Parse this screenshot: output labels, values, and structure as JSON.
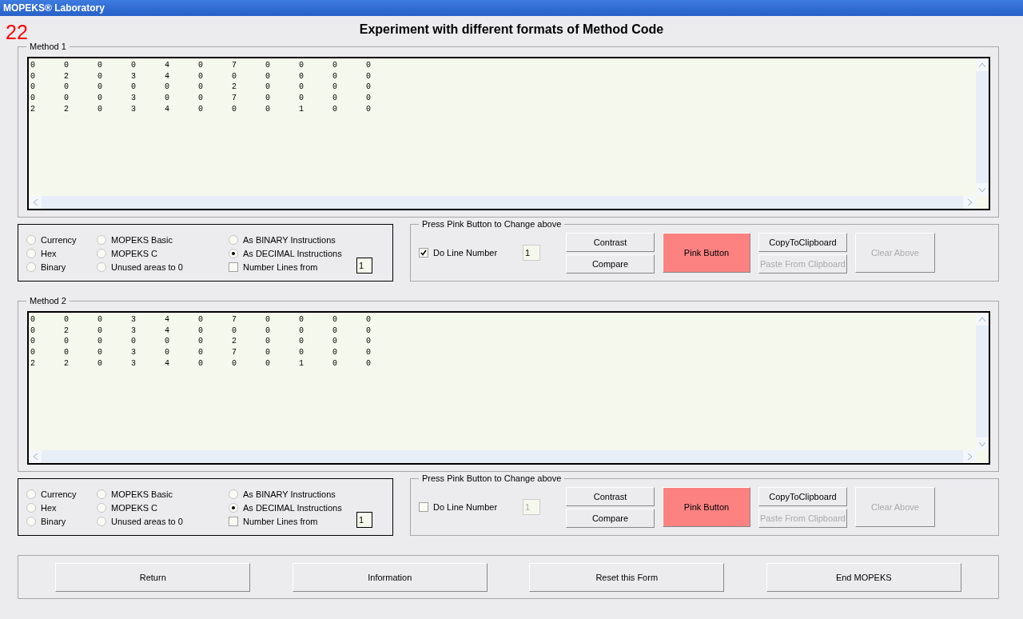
{
  "window": {
    "title": "MOPEKS® Laboratory"
  },
  "form_number": "22",
  "heading": "Experiment with different formats of Method Code",
  "methods": [
    {
      "label": "Method 1",
      "rows": [
        [
          "0",
          "0",
          "0",
          "0",
          "4",
          "0",
          "7",
          "0",
          "0",
          "0",
          "0"
        ],
        [
          "0",
          "2",
          "0",
          "3",
          "4",
          "0",
          "0",
          "0",
          "0",
          "0",
          "0"
        ],
        [
          "0",
          "0",
          "0",
          "0",
          "0",
          "0",
          "2",
          "0",
          "0",
          "0",
          "0"
        ],
        [
          "0",
          "0",
          "0",
          "3",
          "0",
          "0",
          "7",
          "0",
          "0",
          "0",
          "0"
        ],
        [
          "2",
          "2",
          "0",
          "3",
          "4",
          "0",
          "0",
          "0",
          "1",
          "0",
          "0"
        ]
      ],
      "options": [
        {
          "label": "Currency",
          "selected": false
        },
        {
          "label": "Hex",
          "selected": false
        },
        {
          "label": "Binary",
          "selected": false
        },
        {
          "label": "MOPEKS Basic",
          "selected": false
        },
        {
          "label": "MOPEKS C",
          "selected": false
        },
        {
          "label": "Unused areas to 0",
          "selected": false
        },
        {
          "label": "As BINARY Instructions",
          "selected": false
        },
        {
          "label": "As DECIMAL Instructions",
          "selected": true
        }
      ],
      "number_lines": {
        "label": "Number Lines  from",
        "checked": false,
        "value": "1"
      },
      "panel": {
        "legend": "Press Pink Button to Change above",
        "do_line_number": {
          "label": "Do Line Number",
          "checked": true,
          "value": "1"
        },
        "buttons": [
          {
            "label": "Contrast",
            "kind": "small",
            "disabled": false
          },
          {
            "label": "Compare",
            "kind": "small",
            "disabled": false
          },
          {
            "label": "Pink Button",
            "kind": "pink",
            "disabled": false
          },
          {
            "label": "CopyToClipboard",
            "kind": "small",
            "disabled": false
          },
          {
            "label": "Paste From Clipboard",
            "kind": "small",
            "disabled": true
          },
          {
            "label": "Clear Above",
            "kind": "tall",
            "disabled": true
          }
        ]
      }
    },
    {
      "label": "Method 2",
      "rows": [
        [
          "0",
          "0",
          "0",
          "3",
          "4",
          "0",
          "7",
          "0",
          "0",
          "0",
          "0"
        ],
        [
          "0",
          "2",
          "0",
          "3",
          "4",
          "0",
          "0",
          "0",
          "0",
          "0",
          "0"
        ],
        [
          "0",
          "0",
          "0",
          "0",
          "0",
          "0",
          "2",
          "0",
          "0",
          "0",
          "0"
        ],
        [
          "0",
          "0",
          "0",
          "3",
          "0",
          "0",
          "7",
          "0",
          "0",
          "0",
          "0"
        ],
        [
          "2",
          "2",
          "0",
          "3",
          "4",
          "0",
          "0",
          "0",
          "1",
          "0",
          "0"
        ]
      ],
      "options": [
        {
          "label": "Currency",
          "selected": false
        },
        {
          "label": "Hex",
          "selected": false
        },
        {
          "label": "Binary",
          "selected": false
        },
        {
          "label": "MOPEKS Basic",
          "selected": false
        },
        {
          "label": "MOPEKS C",
          "selected": false
        },
        {
          "label": "Unused areas to 0",
          "selected": false
        },
        {
          "label": "As BINARY Instructions",
          "selected": false
        },
        {
          "label": "As DECIMAL Instructions",
          "selected": true
        }
      ],
      "number_lines": {
        "label": "Number Lines  from",
        "checked": false,
        "value": "1"
      },
      "panel": {
        "legend": "Press Pink Button to Change above",
        "do_line_number": {
          "label": "Do Line Number",
          "checked": false,
          "value": "1"
        },
        "buttons": [
          {
            "label": "Contrast",
            "kind": "small",
            "disabled": false
          },
          {
            "label": "Compare",
            "kind": "small",
            "disabled": false
          },
          {
            "label": "Pink Button",
            "kind": "pink",
            "disabled": false
          },
          {
            "label": "CopyToClipboard",
            "kind": "small",
            "disabled": false
          },
          {
            "label": "Paste From Clipboard",
            "kind": "small",
            "disabled": true
          },
          {
            "label": "Clear Above",
            "kind": "tall",
            "disabled": true
          }
        ]
      }
    }
  ],
  "footer_buttons": [
    "Return",
    "Information",
    "Reset this Form",
    "End MOPEKS"
  ]
}
